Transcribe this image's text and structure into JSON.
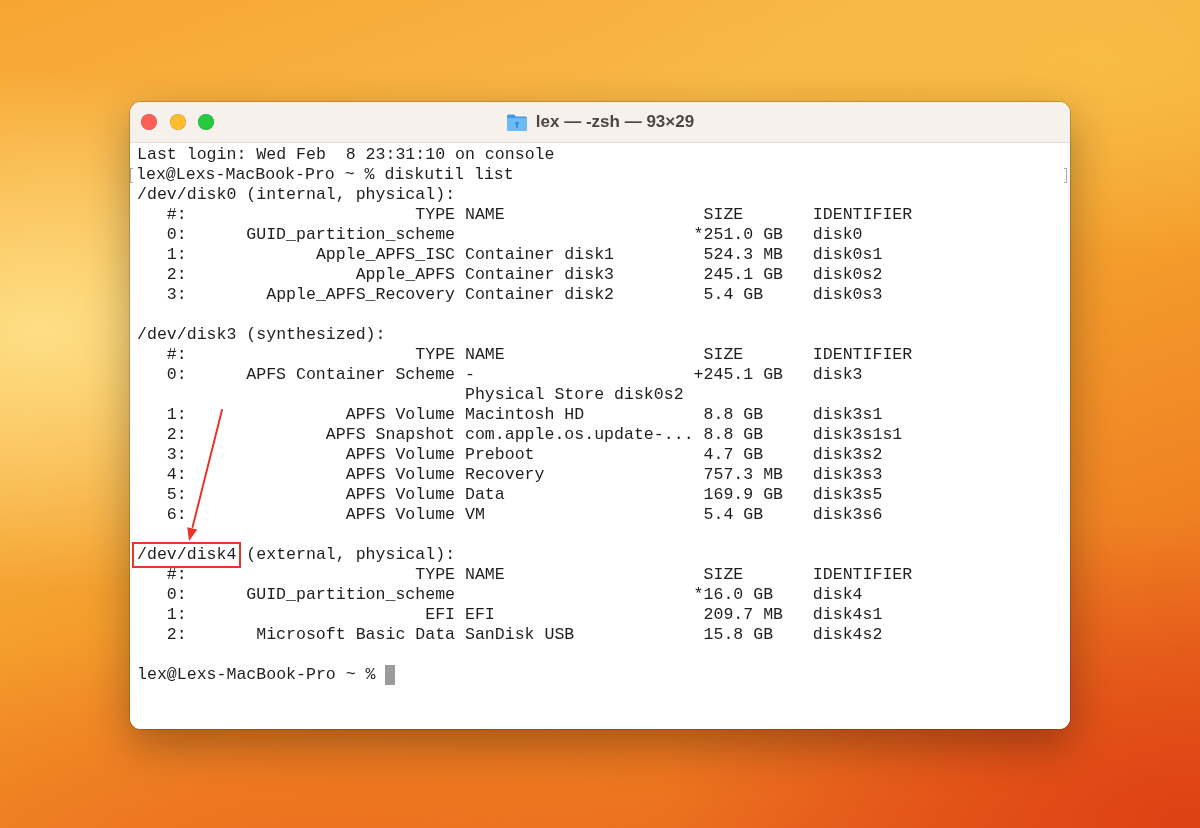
{
  "window": {
    "title": "lex — -zsh — 93×29"
  },
  "terminal": {
    "login_message": "Last login: Wed Feb  8 23:31:10 on console",
    "command_line": {
      "prompt": "lex@Lexs-MacBook-Pro ~ %",
      "command": "diskutil list",
      "marked": true
    },
    "sections": [
      {
        "device": "/dev/disk0",
        "description": "(internal, physical):",
        "highlighted": false,
        "columns": [
          "#:",
          "TYPE",
          "NAME",
          "SIZE",
          "IDENTIFIER"
        ],
        "rows": [
          {
            "index": "0:",
            "type": "GUID_partition_scheme",
            "size_marker": "*",
            "size": "251.0 GB",
            "identifier": "disk0"
          },
          {
            "index": "1:",
            "type": "Apple_APFS_ISC",
            "name": "Container disk1",
            "size": "524.3 MB",
            "identifier": "disk0s1"
          },
          {
            "index": "2:",
            "type": "Apple_APFS",
            "name": "Container disk3",
            "size": "245.1 GB",
            "identifier": "disk0s2"
          },
          {
            "index": "3:",
            "type": "Apple_APFS_Recovery",
            "name": "Container disk2",
            "size": "5.4 GB",
            "identifier": "disk0s3"
          }
        ]
      },
      {
        "device": "/dev/disk3",
        "description": "(synthesized):",
        "highlighted": false,
        "columns": [
          "#:",
          "TYPE",
          "NAME",
          "SIZE",
          "IDENTIFIER"
        ],
        "rows": [
          {
            "index": "0:",
            "type": "APFS Container Scheme",
            "name": "-",
            "detail": "Physical Store disk0s2",
            "size_marker": "+",
            "size": "245.1 GB",
            "identifier": "disk3"
          },
          {
            "index": "1:",
            "type": "APFS Volume",
            "name": "Macintosh HD",
            "size": "8.8 GB",
            "identifier": "disk3s1"
          },
          {
            "index": "2:",
            "type": "APFS Snapshot",
            "name": "com.apple.os.update-...",
            "size": "8.8 GB",
            "identifier": "disk3s1s1"
          },
          {
            "index": "3:",
            "type": "APFS Volume",
            "name": "Preboot",
            "size": "4.7 GB",
            "identifier": "disk3s2"
          },
          {
            "index": "4:",
            "type": "APFS Volume",
            "name": "Recovery",
            "size": "757.3 MB",
            "identifier": "disk3s3"
          },
          {
            "index": "5:",
            "type": "APFS Volume",
            "name": "Data",
            "size": "169.9 GB",
            "identifier": "disk3s5"
          },
          {
            "index": "6:",
            "type": "APFS Volume",
            "name": "VM",
            "size": "5.4 GB",
            "identifier": "disk3s6"
          }
        ]
      },
      {
        "device": "/dev/disk4",
        "description": "(external, physical):",
        "highlighted": true,
        "columns": [
          "#:",
          "TYPE",
          "NAME",
          "SIZE",
          "IDENTIFIER"
        ],
        "rows": [
          {
            "index": "0:",
            "type": "GUID_partition_scheme",
            "size_marker": "*",
            "size": "16.0 GB",
            "identifier": "disk4"
          },
          {
            "index": "1:",
            "type": "EFI",
            "name": "EFI",
            "size": "209.7 MB",
            "identifier": "disk4s1"
          },
          {
            "index": "2:",
            "type": "Microsoft Basic Data",
            "name": "SanDisk USB",
            "size": "15.8 GB",
            "identifier": "disk4s2"
          }
        ]
      }
    ],
    "final_prompt": {
      "prompt": "lex@Lexs-MacBook-Pro ~ %",
      "cursor": true
    }
  }
}
